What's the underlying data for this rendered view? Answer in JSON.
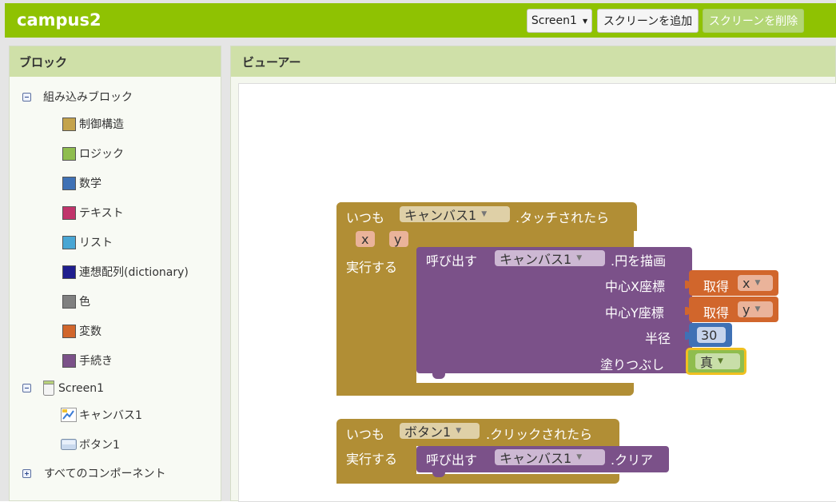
{
  "app": {
    "title": "campus2"
  },
  "toolbar": {
    "screen_select": "Screen1",
    "add_screen": "スクリーンを追加",
    "remove_screen": "スクリーンを削除"
  },
  "blocks_panel": {
    "header": "ブロック",
    "builtin_label": "組み込みブロック",
    "categories": [
      {
        "label": "制御構造",
        "color": "#c4a34c"
      },
      {
        "label": "ロジック",
        "color": "#8fbd4e"
      },
      {
        "label": "数学",
        "color": "#3f71b5"
      },
      {
        "label": "テキスト",
        "color": "#c0346b"
      },
      {
        "label": "リスト",
        "color": "#49a6d4"
      },
      {
        "label": "連想配列(dictionary)",
        "color": "#1f1e8e"
      },
      {
        "label": "色",
        "color": "#808080"
      },
      {
        "label": "変数",
        "color": "#d1662c"
      },
      {
        "label": "手続き",
        "color": "#7b5189"
      }
    ],
    "screen_label": "Screen1",
    "components": [
      "キャンバス1",
      "ボタン1"
    ],
    "all_components": "すべてのコンポーネント"
  },
  "viewer": {
    "header": "ビューアー",
    "block1": {
      "when": "いつも",
      "component": "キャンバス1",
      "event": ".タッチされたら",
      "params": [
        "x",
        "y"
      ],
      "do": "実行する",
      "call": "呼び出す",
      "call_component": "キャンバス1",
      "method": ".円を描画",
      "arg_labels": [
        "中心X座標",
        "中心Y座標",
        "半径",
        "塗りつぶし"
      ],
      "get_label": "取得",
      "get_vars": [
        "x",
        "y"
      ],
      "radius_value": "30",
      "fill_value": "真"
    },
    "block2": {
      "when": "いつも",
      "component": "ボタン1",
      "event": ".クリックされたら",
      "do": "実行する",
      "call": "呼び出す",
      "call_component": "キャンバス1",
      "method": ".クリア"
    }
  }
}
